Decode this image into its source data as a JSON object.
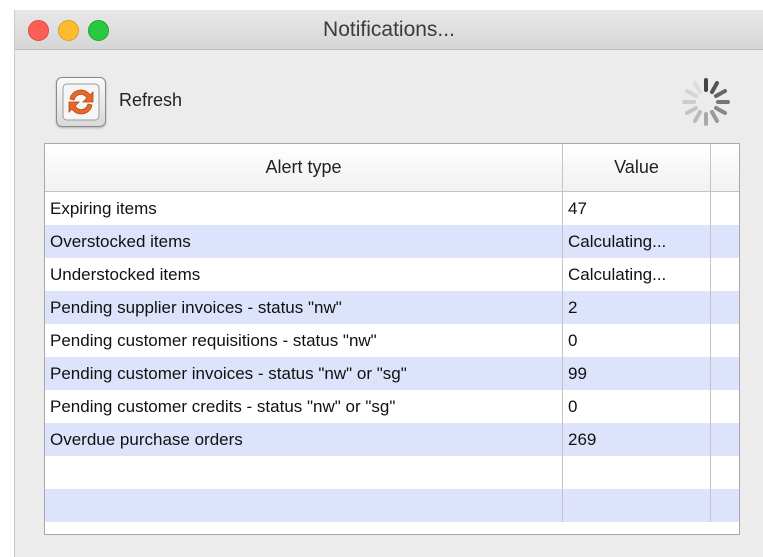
{
  "window": {
    "title": "Notifications..."
  },
  "toolbar": {
    "refresh_label": "Refresh",
    "refresh_icon": "refresh-arrows-icon",
    "spinner_icon": "loading-spinner-icon"
  },
  "table": {
    "columns": [
      "Alert type",
      "Value"
    ],
    "rows": [
      {
        "alert": "Expiring items",
        "value": "47"
      },
      {
        "alert": "Overstocked items",
        "value": "Calculating..."
      },
      {
        "alert": "Understocked items",
        "value": "Calculating..."
      },
      {
        "alert": "Pending supplier invoices - status \"nw\"",
        "value": "2"
      },
      {
        "alert": "Pending customer requisitions - status \"nw\"",
        "value": "0"
      },
      {
        "alert": "Pending customer invoices - status \"nw\" or \"sg\"",
        "value": "99"
      },
      {
        "alert": "Pending customer credits - status \"nw\" or \"sg\"",
        "value": "0"
      },
      {
        "alert": "Overdue purchase orders",
        "value": "269"
      }
    ],
    "empty_rows": 2
  },
  "colors": {
    "row_alt": "#dce3fb",
    "close": "#fc5f57",
    "minimize": "#fdbc2e",
    "maximize": "#28c840",
    "refresh_icon_orange": "#e8682a"
  }
}
